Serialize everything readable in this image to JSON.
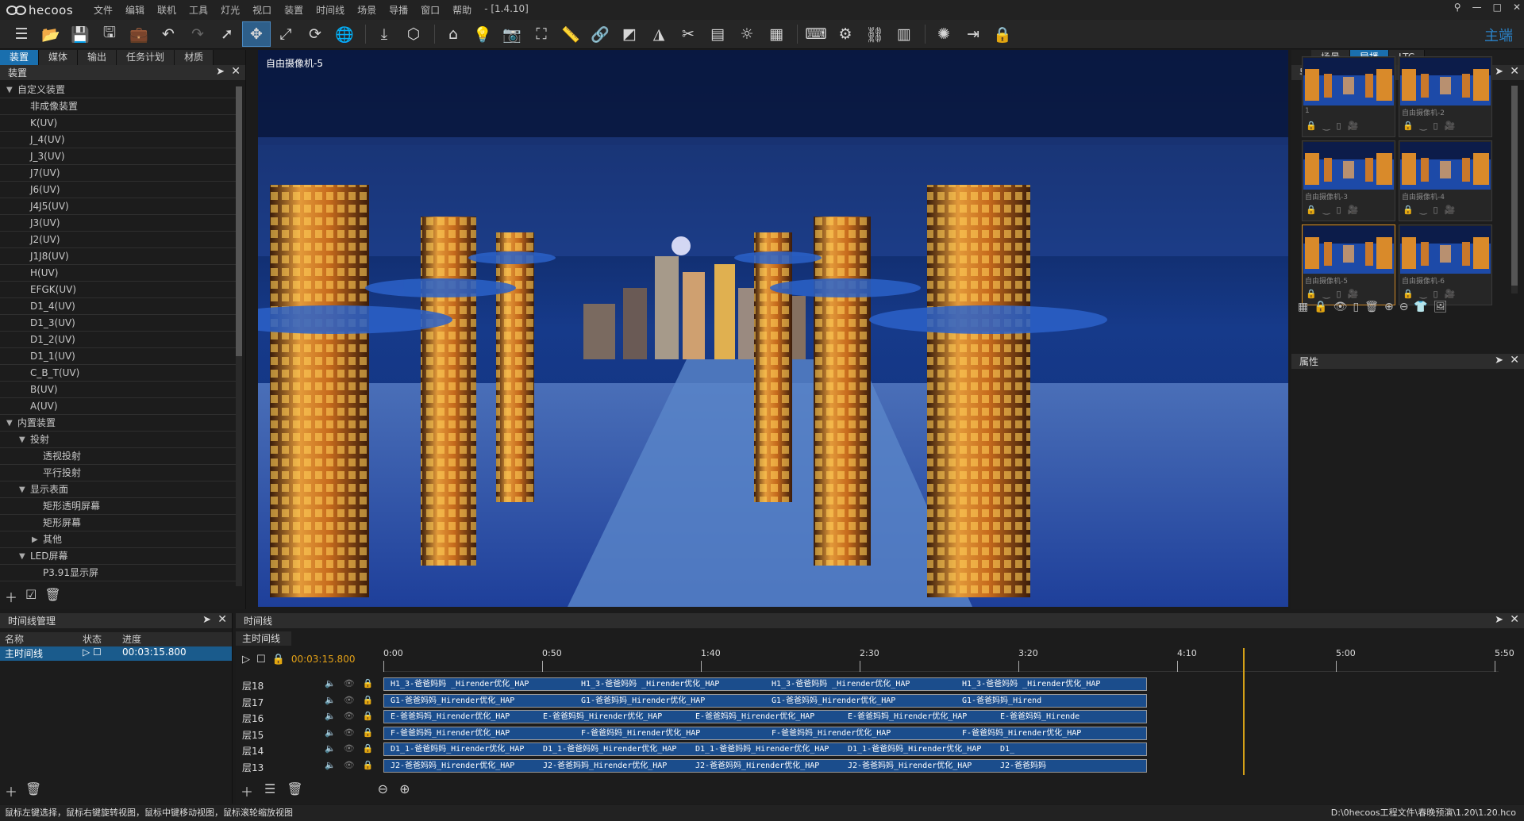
{
  "app": {
    "name": "hecoos",
    "version": "- [1.4.10]"
  },
  "menu": [
    "文件",
    "编辑",
    "联机",
    "工具",
    "灯光",
    "视口",
    "装置",
    "时间线",
    "场景",
    "导播",
    "窗口",
    "帮助"
  ],
  "window_controls": {
    "user": "⚲",
    "min": "—",
    "max": "□",
    "close": "✕"
  },
  "toolbar": {
    "main_label": "主端",
    "icons": [
      "list-icon",
      "open-icon",
      "save-icon",
      "save-as-icon",
      "briefcase-icon",
      "undo-icon",
      "redo-icon",
      "select-icon",
      "move-icon",
      "scale-icon",
      "rotate-icon",
      "globe-icon",
      "import-icon",
      "cube-icon",
      "projector-icon",
      "light-icon",
      "camera-icon",
      "screenshot-icon",
      "ruler-icon",
      "link-icon",
      "mask-icon",
      "grid-icon",
      "tools-icon",
      "fps-icon",
      "brightness-icon",
      "layout-icon",
      "keyboard-icon",
      "render-icon",
      "network-icon",
      "sequence-icon",
      "sun-icon",
      "export-icon",
      "lock-icon"
    ]
  },
  "left_panel": {
    "tabs": [
      "装置",
      "媒体",
      "输出",
      "任务计划",
      "材质"
    ],
    "header": "装置",
    "tree": [
      {
        "label": "自定义装置",
        "level": 0,
        "arrow": "▼"
      },
      {
        "label": "非成像装置",
        "level": 1
      },
      {
        "label": "K(UV)",
        "level": 1
      },
      {
        "label": "J_4(UV)",
        "level": 1
      },
      {
        "label": "J_3(UV)",
        "level": 1
      },
      {
        "label": "J7(UV)",
        "level": 1
      },
      {
        "label": "J6(UV)",
        "level": 1
      },
      {
        "label": "J4J5(UV)",
        "level": 1
      },
      {
        "label": "J3(UV)",
        "level": 1
      },
      {
        "label": "J2(UV)",
        "level": 1
      },
      {
        "label": "J1J8(UV)",
        "level": 1
      },
      {
        "label": "H(UV)",
        "level": 1
      },
      {
        "label": "EFGK(UV)",
        "level": 1
      },
      {
        "label": "D1_4(UV)",
        "level": 1
      },
      {
        "label": "D1_3(UV)",
        "level": 1
      },
      {
        "label": "D1_2(UV)",
        "level": 1
      },
      {
        "label": "D1_1(UV)",
        "level": 1
      },
      {
        "label": "C_B_T(UV)",
        "level": 1
      },
      {
        "label": "B(UV)",
        "level": 1
      },
      {
        "label": "A(UV)",
        "level": 1
      },
      {
        "label": "内置装置",
        "level": 0,
        "arrow": "▼"
      },
      {
        "label": "投射",
        "level": 1,
        "arrow": "▼"
      },
      {
        "label": "透视投射",
        "level": 2
      },
      {
        "label": "平行投射",
        "level": 2
      },
      {
        "label": "显示表面",
        "level": 1,
        "arrow": "▼"
      },
      {
        "label": "矩形透明屏幕",
        "level": 2
      },
      {
        "label": "矩形屏幕",
        "level": 2
      },
      {
        "label": "其他",
        "level": 2,
        "arrow": "▶"
      },
      {
        "label": "LED屏幕",
        "level": 1,
        "arrow": "▼"
      },
      {
        "label": "P3.91显示屏",
        "level": 2
      }
    ]
  },
  "viewport": {
    "camera_label": "自由摄像机-5"
  },
  "right_panel": {
    "tabs": [
      "场景",
      "导播",
      "LTC"
    ],
    "header": "导播",
    "cameras": [
      {
        "label": "1",
        "selected": false
      },
      {
        "label": "自由摄像机-2",
        "selected": false
      },
      {
        "label": "自由摄像机-3",
        "selected": false
      },
      {
        "label": "自由摄像机-4",
        "selected": false
      },
      {
        "label": "自由摄像机-5",
        "selected": true
      },
      {
        "label": "自由摄像机-6",
        "selected": false
      }
    ],
    "properties_header": "属性"
  },
  "timeline_manager": {
    "header": "时间线管理",
    "columns": [
      "名称",
      "状态",
      "进度"
    ],
    "rows": [
      {
        "name": "主时间线",
        "progress": "00:03:15.800"
      }
    ]
  },
  "timeline": {
    "header": "时间线",
    "sub_tab": "主时间线",
    "current_time": "00:03:15.800",
    "ruler": [
      "0:00",
      "0:50",
      "1:40",
      "2:30",
      "3:20",
      "4:10",
      "5:00",
      "5:50"
    ],
    "tracks": [
      {
        "name": "层18",
        "clips": [
          "H1_3-爸爸妈妈 _Hirender优化_HAP",
          "H1_3-爸爸妈妈 _Hirender优化_HAP",
          "H1_3-爸爸妈妈 _Hirender优化_HAP",
          "H1_3-爸爸妈妈 _Hirender优化_HAP"
        ]
      },
      {
        "name": "层17",
        "clips": [
          "G1-爸爸妈妈_Hirender优化_HAP",
          "G1-爸爸妈妈_Hirender优化_HAP",
          "G1-爸爸妈妈_Hirender优化_HAP",
          "G1-爸爸妈妈_Hirend"
        ]
      },
      {
        "name": "层16",
        "clips": [
          "E-爸爸妈妈_Hirender优化_HAP",
          "E-爸爸妈妈_Hirender优化_HAP",
          "E-爸爸妈妈_Hirender优化_HAP",
          "E-爸爸妈妈_Hirender优化_HAP",
          "E-爸爸妈妈_Hirende"
        ]
      },
      {
        "name": "层15",
        "clips": [
          "F-爸爸妈妈_Hirender优化_HAP",
          "F-爸爸妈妈_Hirender优化_HAP",
          "F-爸爸妈妈_Hirender优化_HAP",
          "F-爸爸妈妈_Hirender优化_HAP"
        ]
      },
      {
        "name": "层14",
        "clips": [
          "D1_1-爸爸妈妈_Hirender优化_HAP",
          "D1_1-爸爸妈妈_Hirender优化_HAP",
          "D1_1-爸爸妈妈_Hirender优化_HAP",
          "D1_1-爸爸妈妈_Hirender优化_HAP",
          "D1_"
        ]
      },
      {
        "name": "层13",
        "clips": [
          "J2-爸爸妈妈_Hirender优化_HAP",
          "J2-爸爸妈妈_Hirender优化_HAP",
          "J2-爸爸妈妈_Hirender优化_HAP",
          "J2-爸爸妈妈_Hirender优化_HAP",
          "J2-爸爸妈妈"
        ]
      }
    ]
  },
  "status": {
    "hint": "鼠标左键选择，鼠标右键旋转视图，鼠标中键移动视图，鼠标滚轮缩放视图",
    "path": "D:\\0hecoos工程文件\\春晚预演\\1.20\\1.20.hco"
  },
  "colors": {
    "accent": "#1a6fae",
    "selection_orange": "#d08a2a",
    "clip_blue": "#1b4d8c",
    "playhead": "#d4a017"
  }
}
